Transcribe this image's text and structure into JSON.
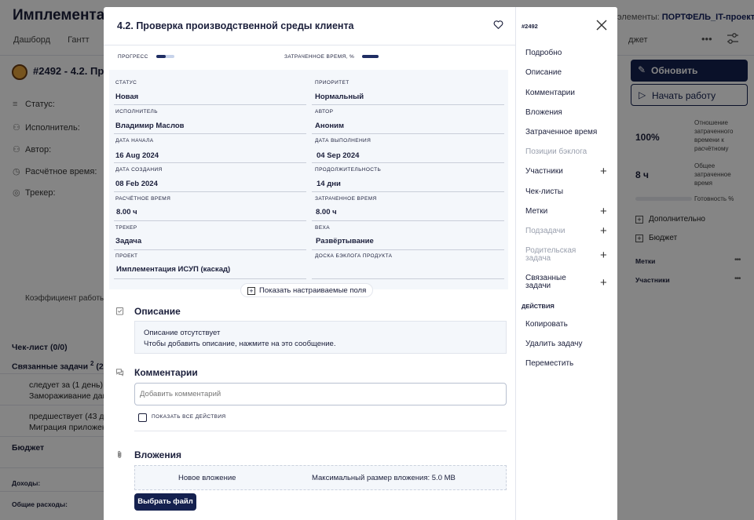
{
  "background": {
    "title": "Имплементаци",
    "portfolio_label": "элементы:",
    "portfolio_value": "ПОРТФЕЛЬ_IT-проекты",
    "nav": [
      "Дашборд",
      "Гантт",
      "За"
    ],
    "nav_right": "джет",
    "more": "•••",
    "task_title": "#2492 - 4.2. Пр",
    "fields": [
      "Статус:",
      "Исполнитель:",
      "Автор:",
      "Расчётное время:",
      "Трекер:"
    ],
    "coefficient": "Коэффициент работы",
    "checklist": "Чек-лист (0/0)",
    "related_title": "Связанные задачи",
    "related_count": "2",
    "related_suffix": "(2 о",
    "related_items": [
      {
        "line1": "следует за (1 день) I",
        "line2": "Замораживание дан"
      },
      {
        "line1": "предшествует (43 д",
        "line2": "Миграция приложен"
      }
    ],
    "budget": "Бюджет",
    "income": "Доходы:",
    "expenses": "Общие расходы:",
    "update_button": "Обновить",
    "start_button": "Начать работу",
    "stat1_value": "100%",
    "stat1_note": "Отношение затраченного времени к расчётному",
    "stat2_value": "8 ч",
    "stat2_note": "Общее затраченное время",
    "readiness_note": "Готовность %",
    "readiness_value": 0,
    "expand_more": "Дополнительно",
    "expand_budget": "Бюджет",
    "labels_row": "Метки",
    "participants_row": "Участники",
    "dots": "•••"
  },
  "modal": {
    "title": "4.2. Проверка производственной среды клиента",
    "task_id": "#2492",
    "progress_label": "ПРОГРЕСС",
    "progress_value": 0.5,
    "time_label": "ЗАТРАЧЕННОЕ ВРЕМЯ, %",
    "time_value": 1.0,
    "fields": [
      {
        "label": "СТАТУС",
        "value": "Новая"
      },
      {
        "label": "ПРИОРИТЕТ",
        "value": "Нормальный"
      },
      {
        "label": "ИСПОЛНИТЕЛЬ",
        "value": "Владимир Маслов"
      },
      {
        "label": "АВТОР",
        "value": "Аноним"
      },
      {
        "label": "ДАТА НАЧАЛА",
        "value": "16 Aug 2024"
      },
      {
        "label": "ДАТА ВЫПОЛНЕНИЯ",
        "value": "04 Sep 2024"
      },
      {
        "label": "ДАТА СОЗДАНИЯ",
        "value": "08 Feb 2024"
      },
      {
        "label": "ПРОДОЛЖИТЕЛЬНОСТЬ",
        "value": "14 дни"
      },
      {
        "label": "РАСЧЁТНОЕ ВРЕМЯ",
        "value": "8.00 ч"
      },
      {
        "label": "ЗАТРАЧЕННОЕ ВРЕМЯ",
        "value": "8.00 ч"
      },
      {
        "label": "ТРЕКЕР",
        "value": "Задача"
      },
      {
        "label": "ВЕХА",
        "value": "Развёртывание"
      },
      {
        "label": "ПРОЕКТ",
        "value": "Имплементация ИСУП (каскад)"
      },
      {
        "label": "ДОСКА БЭКЛОГА ПРОДУКТА",
        "value": ""
      }
    ],
    "show_custom_fields": "Показать настраиваемые поля",
    "description_title": "Описание",
    "description_empty": "Описание отсутствует",
    "description_hint": "Чтобы добавить описание, нажмите на это сообщение.",
    "comments_title": "Комментарии",
    "comment_placeholder": "Добавить комментарий",
    "show_all_actions": "ПОКАЗАТЬ ВСЕ ДЕЙСТВИЯ",
    "attachments_title": "Вложения",
    "new_attachment": "Новое вложение",
    "max_size": "Максимальный размер вложения: 5.0 MB",
    "choose_file": "Выбрать файл",
    "nav": [
      {
        "label": "Подробно",
        "disabled": false,
        "plus": false
      },
      {
        "label": "Описание",
        "disabled": false,
        "plus": false
      },
      {
        "label": "Комментарии",
        "disabled": false,
        "plus": false
      },
      {
        "label": "Вложения",
        "disabled": false,
        "plus": false
      },
      {
        "label": "Затраченное время",
        "disabled": false,
        "plus": false
      },
      {
        "label": "Позиции бэклога",
        "disabled": true,
        "plus": false
      },
      {
        "label": "Участники",
        "disabled": false,
        "plus": true
      },
      {
        "label": "Чек-листы",
        "disabled": false,
        "plus": false
      },
      {
        "label": "Метки",
        "disabled": false,
        "plus": true
      },
      {
        "label": "Подзадачи",
        "disabled": true,
        "plus": true
      },
      {
        "label": "Родительская задача",
        "disabled": true,
        "plus": true
      },
      {
        "label": "Связанные задачи",
        "disabled": false,
        "plus": true
      }
    ],
    "actions_title": "ДЕЙСТВИЯ",
    "actions": [
      "Копировать",
      "Удалить задачу",
      "Переместить"
    ]
  },
  "colors": {
    "primary": "#15214f",
    "field_bg": "#f4f7fb",
    "overlay": "rgba(0,0,0,0.48)"
  }
}
